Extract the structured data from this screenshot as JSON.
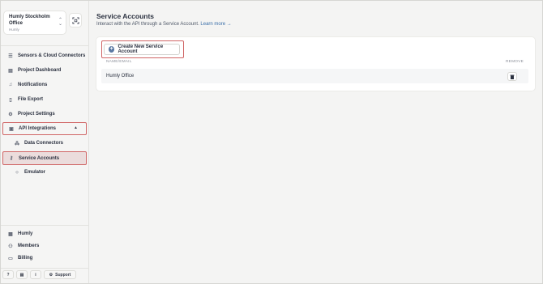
{
  "org": {
    "name": "Humly Stockholm Office",
    "sub": "Humly"
  },
  "nav": {
    "sensors": "Sensors & Cloud Connectors",
    "dashboard": "Project Dashboard",
    "notifications": "Notifications",
    "file_export": "File Export",
    "settings": "Project Settings",
    "api": "API Integrations",
    "data_connectors": "Data Connectors",
    "service_accounts": "Service Accounts",
    "emulator": "Emulator",
    "humly": "Humly",
    "members": "Members",
    "billing": "Billing",
    "support": "Support"
  },
  "page": {
    "title": "Service Accounts",
    "subtitle": "Interact with the API through a Service Account.",
    "learn_more": "Learn more →",
    "create_button": "Create New Service Account",
    "col_name": "NAME/EMAIL",
    "col_remove": "REMOVE"
  },
  "rows": [
    {
      "name": "Humly Office"
    }
  ],
  "colors": {
    "highlight": "#d06565",
    "accent": "#5a79a3",
    "active_bg": "#ebdcdc"
  }
}
